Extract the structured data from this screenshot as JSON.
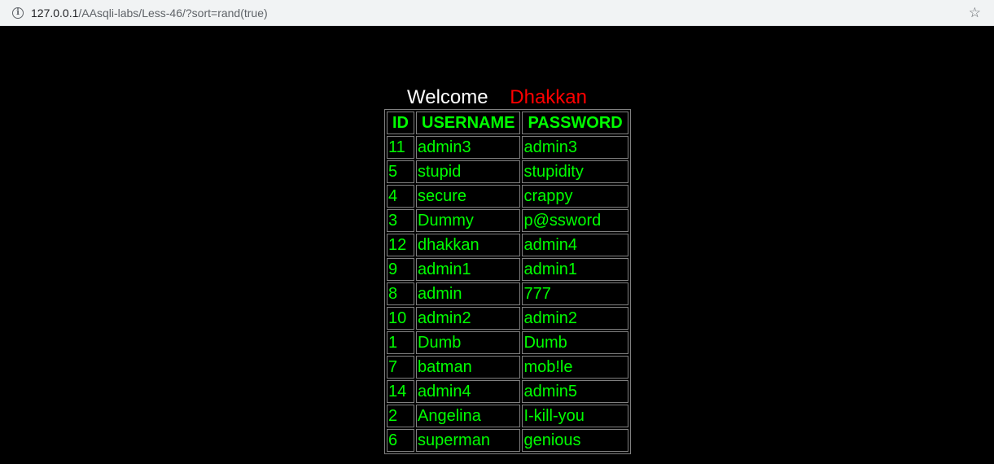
{
  "browser": {
    "url_host": "127.0.0.1",
    "url_path": "/AAsqli-labs/Less-46/?sort=rand(true)",
    "info_icon": "info-icon",
    "bookmark_icon": "star-icon"
  },
  "welcome": {
    "greeting": "Welcome",
    "name": "Dhakkan",
    "greeting_color": "#ffffff",
    "name_color": "#ff0000"
  },
  "table": {
    "text_color": "#00ff00",
    "headers": [
      "ID",
      "USERNAME",
      "PASSWORD"
    ],
    "rows": [
      [
        "11",
        "admin3",
        "admin3"
      ],
      [
        "5",
        "stupid",
        "stupidity"
      ],
      [
        "4",
        "secure",
        "crappy"
      ],
      [
        "3",
        "Dummy",
        "p@ssword"
      ],
      [
        "12",
        "dhakkan",
        "admin4"
      ],
      [
        "9",
        "admin1",
        "admin1"
      ],
      [
        "8",
        "admin",
        "777"
      ],
      [
        "10",
        "admin2",
        "admin2"
      ],
      [
        "1",
        "Dumb",
        "Dumb"
      ],
      [
        "7",
        "batman",
        "mob!le"
      ],
      [
        "14",
        "admin4",
        "admin5"
      ],
      [
        "2",
        "Angelina",
        "I-kill-you"
      ],
      [
        "6",
        "superman",
        "genious"
      ]
    ]
  }
}
